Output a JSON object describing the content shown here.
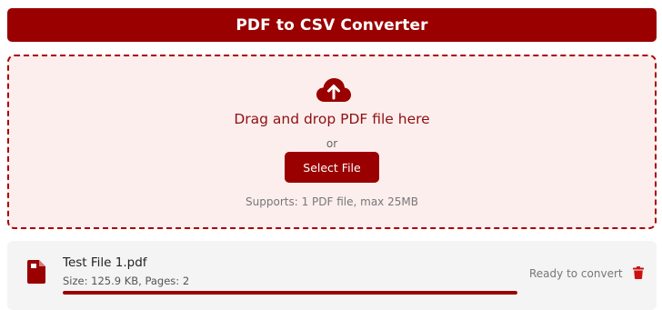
{
  "header": {
    "title": "PDF to CSV Converter"
  },
  "dropzone": {
    "icon": "cloud-upload-icon",
    "prompt": "Drag and drop PDF file here",
    "or": "or",
    "select_button": "Select File",
    "supports": "Supports: 1 PDF file, max 25MB"
  },
  "file": {
    "icon": "pdf-file-icon",
    "name": "Test File 1.pdf",
    "meta": "Size: 125.9 KB, Pages: 2",
    "progress": 1.0,
    "status": "Ready to convert",
    "delete_icon": "trash-icon"
  },
  "colors": {
    "accent": "#9a0000",
    "dropzone_bg": "#fdeeee",
    "file_row_bg": "#f4f4f4"
  }
}
